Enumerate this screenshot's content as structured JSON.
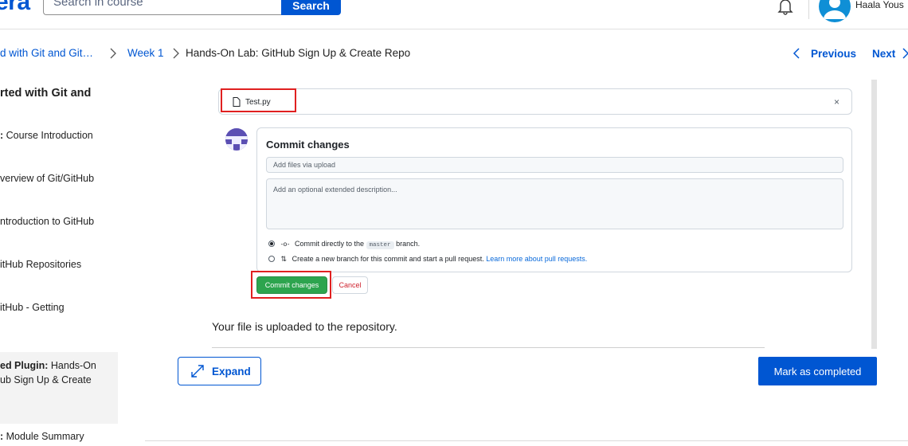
{
  "header": {
    "logo_text": "era",
    "search": {
      "placeholder": "Search in course",
      "button_label": "Search"
    },
    "user_name": "Haala Yous"
  },
  "breadcrumb": {
    "items": [
      "d with Git and Git…",
      "Week 1",
      "Hands-On Lab: GitHub Sign Up & Create Repo"
    ],
    "previous_label": "Previous",
    "next_label": "Next"
  },
  "sidebar": {
    "title": "rted with Git and",
    "items": [
      {
        "prefix": ":",
        "label": " Course Introduction"
      },
      {
        "prefix": "",
        "label": "verview of Git/GitHub"
      },
      {
        "prefix": "",
        "label": "ntroduction to GitHub"
      },
      {
        "prefix": "",
        "label": "itHub Repositories"
      },
      {
        "prefix": "",
        "label": "itHub - Getting"
      },
      {
        "prefix": "ed Plugin:",
        "label": " Hands-On",
        "line2": "ub Sign Up & Create"
      },
      {
        "prefix": ":",
        "label": " Module Summary"
      }
    ]
  },
  "github_screenshot": {
    "file_name": "Test.py",
    "close_glyph": "×",
    "commit_title": "Commit changes",
    "summary_placeholder": "Add files via upload",
    "description_placeholder": "Add an optional extended description...",
    "option_direct": {
      "text_before": "Commit directly to the",
      "branch": "master",
      "text_after": "branch."
    },
    "option_new": {
      "text_bold": "Create a new branch",
      "text_rest": " for this commit and start a pull request.",
      "link": "Learn more about pull requests."
    },
    "commit_button": "Commit changes",
    "cancel_button": "Cancel"
  },
  "content": {
    "uploaded_text": "Your file is uploaded to the repository."
  },
  "actions": {
    "expand_label": "Expand",
    "mark_completed_label": "Mark as completed"
  },
  "colors": {
    "brand": "#0056d2",
    "github_green": "#2da44e",
    "highlight_red": "#e02020"
  }
}
